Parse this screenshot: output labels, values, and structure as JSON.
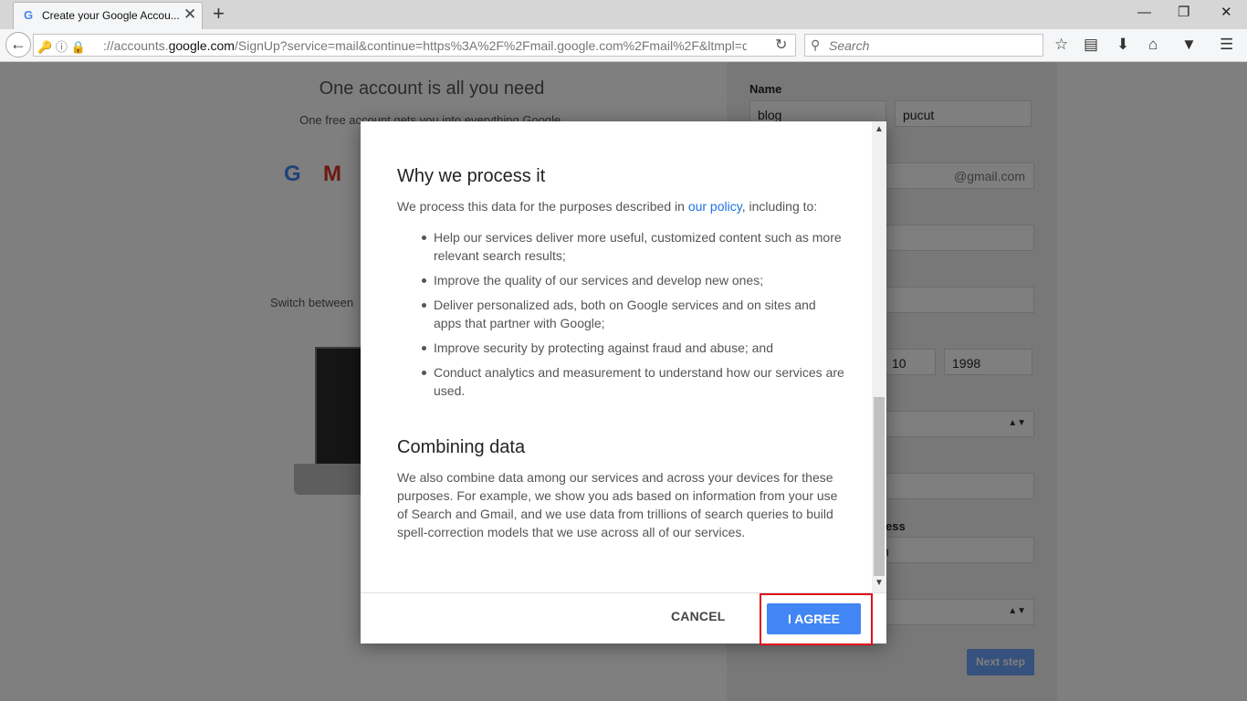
{
  "browser": {
    "tab_title": "Create your Google Accou...",
    "tab_favicon": "G",
    "new_tab": "+",
    "close_tab": "✕",
    "url_prefix": "://accounts.",
    "url_host": "google.com",
    "url_rest": "/SignUp?service=mail&continue=https%3A%2F%2Fmail.google.com%2Fmail%2F&ltmpl=de",
    "search_placeholder": "Search",
    "icons": [
      "back-icon",
      "key-icon",
      "info-icon",
      "lock-icon",
      "reload-icon",
      "search-icon",
      "bookmark-star-icon",
      "reading-list-icon",
      "download-icon",
      "home-icon",
      "pocket-icon",
      "menu-icon"
    ]
  },
  "page": {
    "left_title": "One account is all you need",
    "left_subtitle": "One free account gets you into everything Google.",
    "switch_text": "Switch between",
    "name_label": "Name",
    "first_name": "blog",
    "last_name": "pucut",
    "gmail_suffix": "@gmail.com",
    "birth_day": "10",
    "birth_year": "1998",
    "partial_label": "ess",
    "partial_value": "n",
    "next_step": "Next step"
  },
  "dialog": {
    "heading_process": "Why we process it",
    "intro_before_link": "We process this data for the purposes described in ",
    "intro_link": "our policy",
    "intro_after_link": ", including to:",
    "bullets": [
      "Help our services deliver more useful, customized content such as more relevant search results;",
      "Improve the quality of our services and develop new ones;",
      "Deliver personalized ads, both on Google services and on sites and apps that partner with Google;",
      "Improve security by protecting against fraud and abuse; and",
      "Conduct analytics and measurement to understand how our services are used."
    ],
    "heading_combine": "Combining data",
    "combine_text": "We also combine data among our services and across your devices for these purposes. For example, we show you ads based on information from your use of Search and Gmail, and we use data from trillions of search queries to build spell-correction models that we use across all of our services.",
    "cancel_label": "CANCEL",
    "agree_label": "I AGREE"
  },
  "colors": {
    "agree_button": "#4285f4",
    "link": "#1a73e8",
    "highlight": "#e0101b"
  }
}
